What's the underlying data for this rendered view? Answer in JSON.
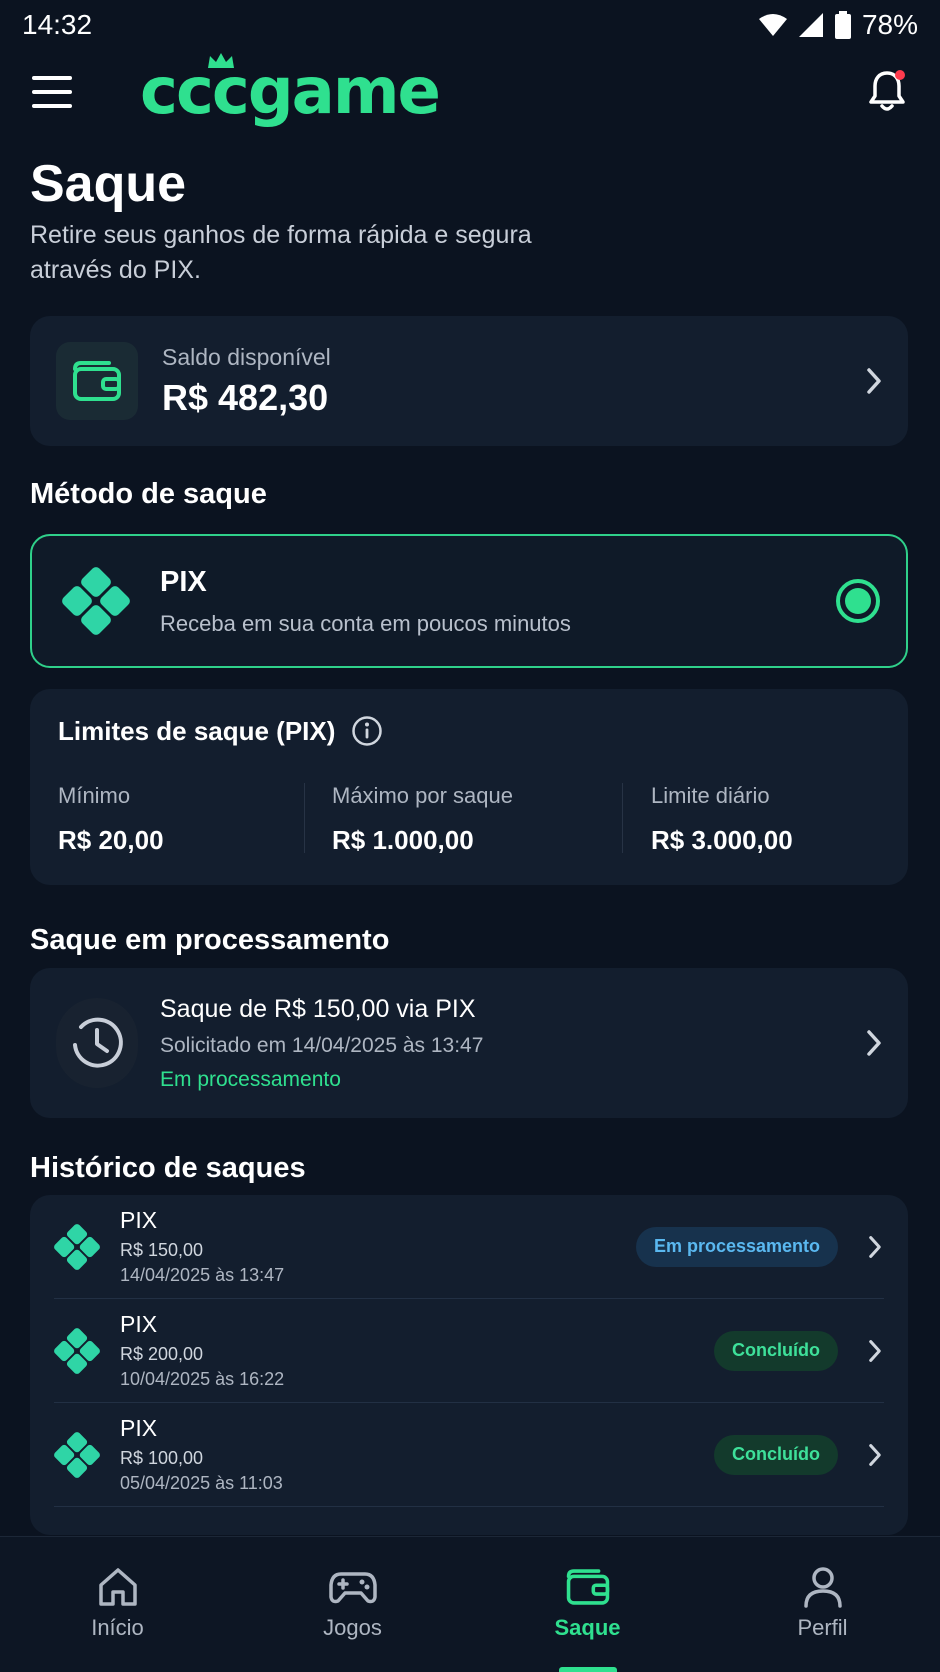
{
  "status_bar": {
    "time": "14:32",
    "battery": "78%"
  },
  "header": {
    "logo": "cccgame"
  },
  "page": {
    "title": "Saque",
    "subtitle": "Retire seus ganhos de forma rápida e segura através do PIX."
  },
  "balance": {
    "label": "Saldo disponível",
    "value": "R$ 482,30"
  },
  "method_section": {
    "title": "Método de saque",
    "method": {
      "name": "PIX",
      "description": "Receba em sua conta em poucos minutos",
      "selected": true
    }
  },
  "limits": {
    "title": "Limites de saque (PIX)",
    "items": [
      {
        "label": "Mínimo",
        "value": "R$ 20,00"
      },
      {
        "label": "Máximo por saque",
        "value": "R$ 1.000,00"
      },
      {
        "label": "Limite diário",
        "value": "R$ 3.000,00"
      }
    ]
  },
  "processing": {
    "title": "Saque em processamento",
    "item": {
      "title": "Saque de R$ 150,00 via PIX",
      "date": "Solicitado em 14/04/2025 às 13:47",
      "status": "Em processamento"
    }
  },
  "history": {
    "title": "Histórico de saques",
    "items": [
      {
        "method": "PIX",
        "amount": "R$ 150,00",
        "date": "14/04/2025 às 13:47",
        "status": "Em processamento"
      },
      {
        "method": "PIX",
        "amount": "R$ 200,00",
        "date": "10/04/2025 às 16:22",
        "status": "Concluído"
      },
      {
        "method": "PIX",
        "amount": "R$ 100,00",
        "date": "05/04/2025 às 11:03",
        "status": "Concluído"
      }
    ]
  },
  "nav": {
    "items": [
      {
        "label": "Início",
        "icon": "home-icon"
      },
      {
        "label": "Jogos",
        "icon": "gamepad-icon"
      },
      {
        "label": "Saque",
        "icon": "wallet-icon",
        "active": true
      },
      {
        "label": "Perfil",
        "icon": "user-icon"
      }
    ]
  },
  "colors": {
    "accent": "#2fe08f",
    "background": "#0b1320",
    "card": "#131e2e",
    "processing_badge": "#5ab8f0"
  }
}
